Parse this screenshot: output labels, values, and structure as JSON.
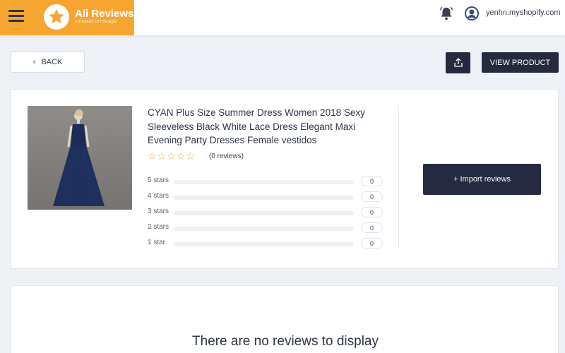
{
  "header": {
    "app_name": "Ali Reviews",
    "app_tagline": "A Product Of FireApps",
    "shop_name": "yenhn.myshopify.com",
    "brand_color": "#f7a531"
  },
  "toolbar": {
    "back_label": "BACK",
    "view_product_label": "VIEW PRODUCT"
  },
  "product": {
    "title": "CYAN Plus Size Summer Dress Women 2018 Sexy Sleeveless Black White Lace Dress Elegant Maxi Evening Party Dresses Female vestidos",
    "rating_filled": 0,
    "rating_max": 5,
    "review_count_text": "(0 reviews)",
    "breakdown": [
      {
        "label": "5 stars",
        "count": "0",
        "fraction": 0
      },
      {
        "label": "4 stars",
        "count": "0",
        "fraction": 0
      },
      {
        "label": "3 stars",
        "count": "0",
        "fraction": 0
      },
      {
        "label": "2 stars",
        "count": "0",
        "fraction": 0
      },
      {
        "label": "1 star",
        "count": "0",
        "fraction": 0
      }
    ],
    "import_label": "+ Import reviews"
  },
  "reviews": {
    "empty_message": "There are no reviews to display"
  },
  "colors": {
    "dark_button": "#252a40",
    "page_bg": "#eef1f6"
  }
}
